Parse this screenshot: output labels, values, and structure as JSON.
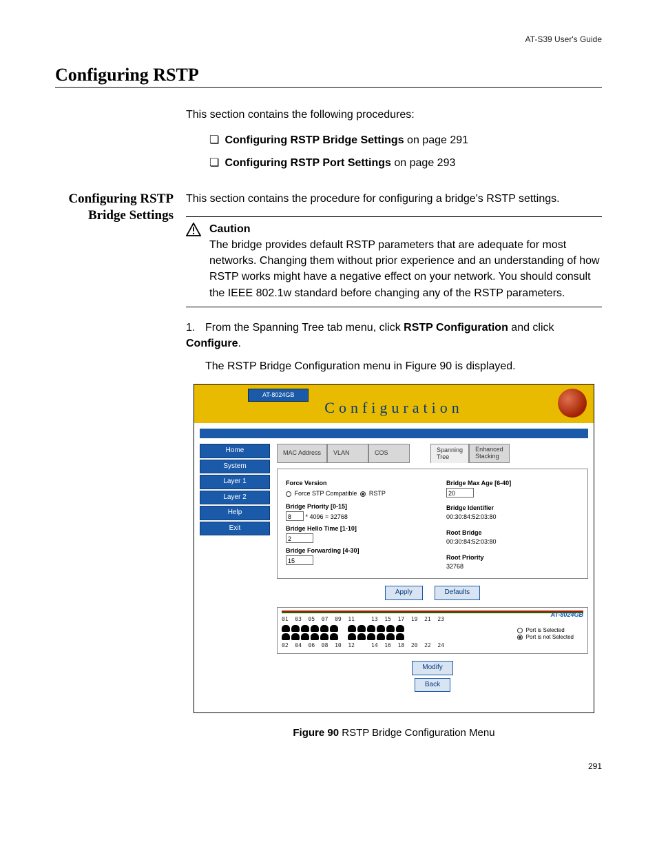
{
  "header_right": "AT-S39 User's Guide",
  "title": "Configuring RSTP",
  "intro": "This section contains the following procedures:",
  "bullets": [
    {
      "strong": "Configuring RSTP Bridge Settings",
      "rest": " on page 291"
    },
    {
      "strong": "Configuring RSTP Port Settings",
      "rest": " on page 293"
    }
  ],
  "side_heading": "Configuring RSTP Bridge Settings",
  "side_intro": "This section contains the procedure for configuring a bridge's RSTP settings.",
  "caution": {
    "title": "Caution",
    "body": "The bridge provides default RSTP parameters that are adequate for most networks. Changing them without prior experience and an understanding of how RSTP works might have a negative effect on your network. You should consult the IEEE 802.1w standard before changing any of the RSTP parameters."
  },
  "step1_pre": "From the Spanning Tree tab menu, click ",
  "step1_b1": "RSTP Configuration",
  "step1_mid": " and click ",
  "step1_b2": "Configure",
  "step1_post": ".",
  "step1_sub": "The RSTP Bridge Configuration menu in Figure 90 is displayed.",
  "figure_caption_b": "Figure 90",
  "figure_caption_rest": "  RSTP Bridge Configuration Menu",
  "page_number": "291",
  "screenshot": {
    "model": "AT-8024GB",
    "banner": "Configuration",
    "nav": [
      "Home",
      "System",
      "Layer 1",
      "Layer 2",
      "Help",
      "Exit"
    ],
    "tabs": [
      "MAC Address",
      "VLAN",
      "COS",
      "Spanning\nTree",
      "Enhanced\nStacking"
    ],
    "left_fields": {
      "force_version_label": "Force Version",
      "force_opt1": "Force STP Compatible",
      "force_opt2": "RSTP",
      "bridge_priority_label": "Bridge Priority [0-15]",
      "bridge_priority_value": "8",
      "bridge_priority_calc": "* 4096 = 32768",
      "hello_label": "Bridge Hello Time [1-10]",
      "hello_value": "2",
      "fwd_label": "Bridge Forwarding [4-30]",
      "fwd_value": "15"
    },
    "right_fields": {
      "maxage_label": "Bridge Max Age [6-40]",
      "maxage_value": "20",
      "bid_label": "Bridge Identifier",
      "bid_value": "00:30:84:52:03:80",
      "root_label": "Root Bridge",
      "root_value": "00:30:84:52:03:80",
      "rp_label": "Root Priority",
      "rp_value": "32768"
    },
    "buttons": {
      "apply": "Apply",
      "defaults": "Defaults",
      "modify": "Modify",
      "back": "Back"
    },
    "port_model": "AT-8024GB",
    "port_row_top": "01  03  05  07  09  11     13  15  17  19  21  23",
    "port_row_bot": "02  04  06  08  10  12     14  16  18  20  22  24",
    "legend_sel": "Port is Selected",
    "legend_unsel": "Port is not Selected"
  }
}
